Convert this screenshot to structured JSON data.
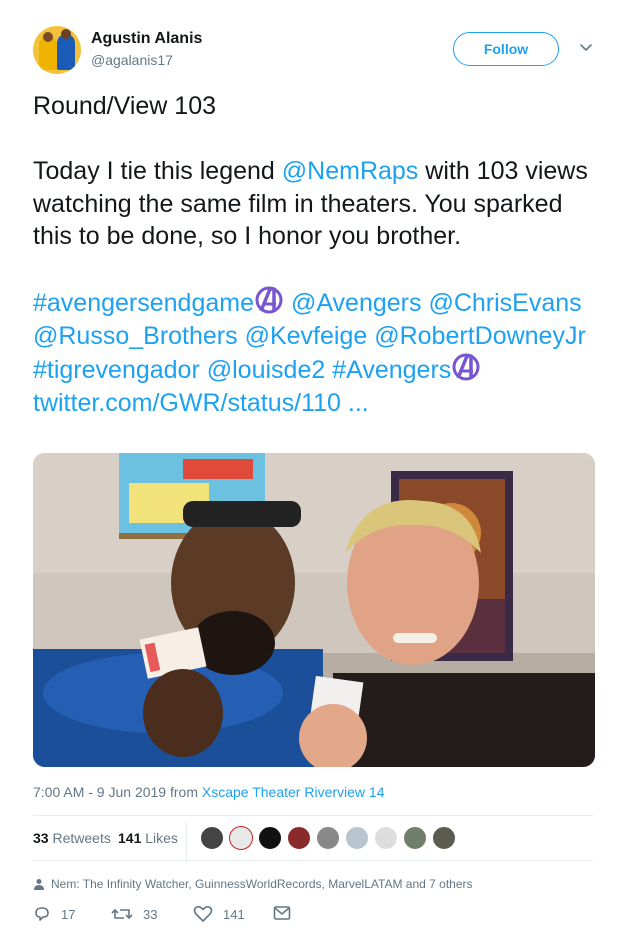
{
  "author": {
    "name": "Agustin Alanis",
    "handle": "@agalanis17",
    "follow_label": "Follow"
  },
  "tweet": {
    "line1": "Round/View 103",
    "p2_a": "Today I tie this legend ",
    "p2_mention": "@NemRaps",
    "p2_b": " with 103 views watching the same film in theaters. You sparked this to be done, so I honor you brother.",
    "tag_endgame": "#avengersendgame",
    "m_avengers": "@Avengers",
    "m_chris": "@ChrisEvans",
    "m_russo": "@Russo_Brothers",
    "m_kev": "@Kevfeige",
    "m_rdj": "@RobertDowneyJr",
    "tag_tigre": "#tigrevengador",
    "m_louise": "@louisde2",
    "tag_avengers": "#Avengers",
    "url": "twitter.com/GWR/status/110 ..."
  },
  "meta": {
    "time": "7:00 AM - 9 Jun 2019 from ",
    "source": "Xscape Theater Riverview 14"
  },
  "stats": {
    "retweets_count": "33",
    "retweets_label": "Retweets",
    "likes_count": "141",
    "likes_label": "Likes"
  },
  "liked_by": "Nem: The Infinity Watcher, GuinnessWorldRecords, MarvelLATAM and 7 others",
  "actions": {
    "replies": "17",
    "retweets": "33",
    "likes": "141"
  },
  "icons": [
    "chevron-down-icon",
    "avengers-logo-icon",
    "person-icon",
    "reply-icon",
    "retweet-icon",
    "heart-icon",
    "mail-icon"
  ],
  "colors": {
    "link": "#1da1f2",
    "text": "#14171a",
    "muted": "#657786"
  }
}
